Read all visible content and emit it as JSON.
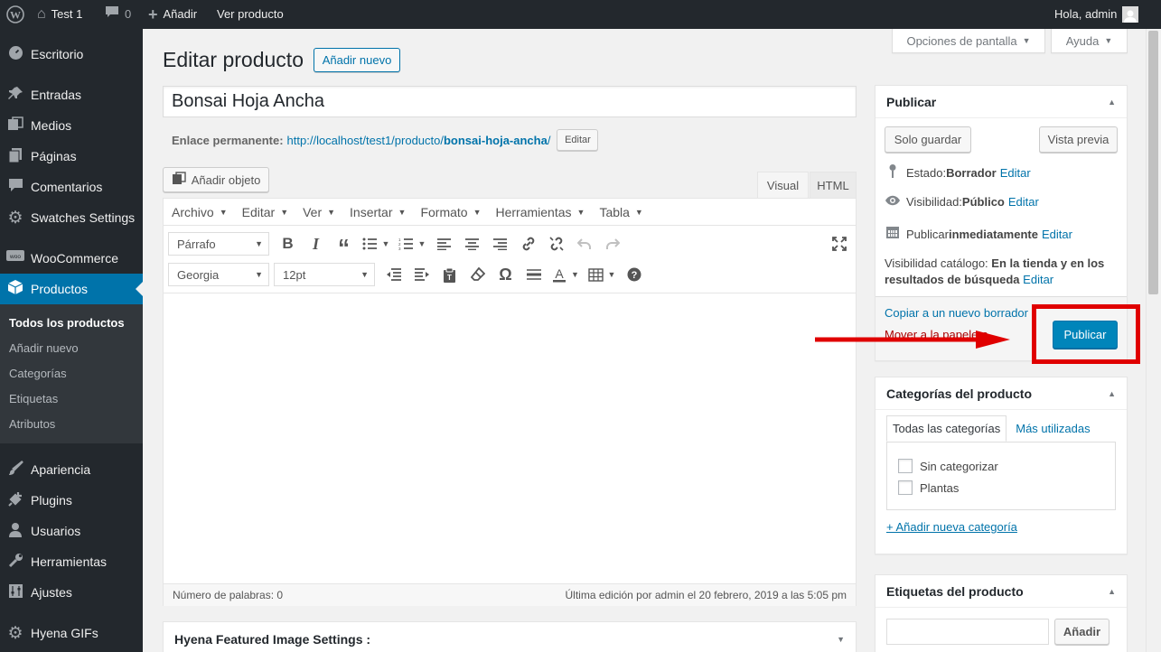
{
  "adminbar": {
    "site_name": "Test 1",
    "comments_count": "0",
    "new_label": "Añadir",
    "view_label": "Ver producto",
    "greeting": "Hola, admin"
  },
  "sidebar": {
    "items": [
      {
        "label": "Escritorio",
        "icon": "dashboard-icon"
      },
      {
        "label": "Entradas",
        "icon": "pin-icon"
      },
      {
        "label": "Medios",
        "icon": "media-icon"
      },
      {
        "label": "Páginas",
        "icon": "page-icon"
      },
      {
        "label": "Comentarios",
        "icon": "comment-icon"
      },
      {
        "label": "Swatches Settings",
        "icon": "gear-icon"
      },
      {
        "label": "WooCommerce",
        "icon": "woo-icon"
      },
      {
        "label": "Productos",
        "icon": "box-icon"
      },
      {
        "label": "Apariencia",
        "icon": "brush-icon"
      },
      {
        "label": "Plugins",
        "icon": "plugin-icon"
      },
      {
        "label": "Usuarios",
        "icon": "user-icon"
      },
      {
        "label": "Herramientas",
        "icon": "wrench-icon"
      },
      {
        "label": "Ajustes",
        "icon": "settings-icon"
      },
      {
        "label": "Hyena GIFs",
        "icon": "gear-icon"
      }
    ],
    "submenu": [
      "Todos los productos",
      "Añadir nuevo",
      "Categorías",
      "Etiquetas",
      "Atributos"
    ]
  },
  "screen_options": {
    "label": "Opciones de pantalla",
    "help": "Ayuda"
  },
  "page": {
    "title": "Editar producto",
    "add_new": "Añadir nuevo",
    "product_title": "Bonsai Hoja Ancha",
    "permalink_label": "Enlace permanente:",
    "permalink_base": "http://localhost/test1/producto/",
    "permalink_slug": "bonsai-hoja-ancha",
    "permalink_end": "/",
    "edit_slug": "Editar"
  },
  "editor": {
    "add_media": "Añadir objeto",
    "tab_visual": "Visual",
    "tab_html": "HTML",
    "menu": [
      "Archivo",
      "Editar",
      "Ver",
      "Insertar",
      "Formato",
      "Herramientas",
      "Tabla"
    ],
    "format_select": "Párrafo",
    "font_select": "Georgia",
    "size_select": "12pt",
    "word_count": "Número de palabras: 0",
    "last_edit": "Última edición por admin el 20 febrero, 2019 a las 5:05 pm"
  },
  "hyena_box": {
    "title": "Hyena Featured Image Settings :"
  },
  "publish_box": {
    "title": "Publicar",
    "save_draft": "Solo guardar",
    "preview": "Vista previa",
    "status_label": "Estado: ",
    "status_value": "Borrador",
    "visibility_label": "Visibilidad: ",
    "visibility_value": "Público",
    "publish_label": "Publicar ",
    "publish_value": "inmediatamente",
    "edit": "Editar",
    "catalog_label": "Visibilidad catálogo: ",
    "catalog_value_1": "En la tienda y en los",
    "catalog_value_2": "resultados de búsqueda",
    "copy_draft": "Copiar a un nuevo borrador",
    "trash": "Mover a la papelera",
    "publish_button": "Publicar"
  },
  "categories_box": {
    "title": "Categorías del producto",
    "tab_all": "Todas las categorías",
    "tab_popular": "Más utilizadas",
    "items": [
      "Sin categorizar",
      "Plantas"
    ],
    "add_new": "+ Añadir nueva categoría"
  },
  "tags_box": {
    "title": "Etiquetas del producto",
    "add_button": "Añadir"
  },
  "colors": {
    "accent": "#0073aa",
    "highlight": "#e00000",
    "sidebar": "#23282d"
  }
}
